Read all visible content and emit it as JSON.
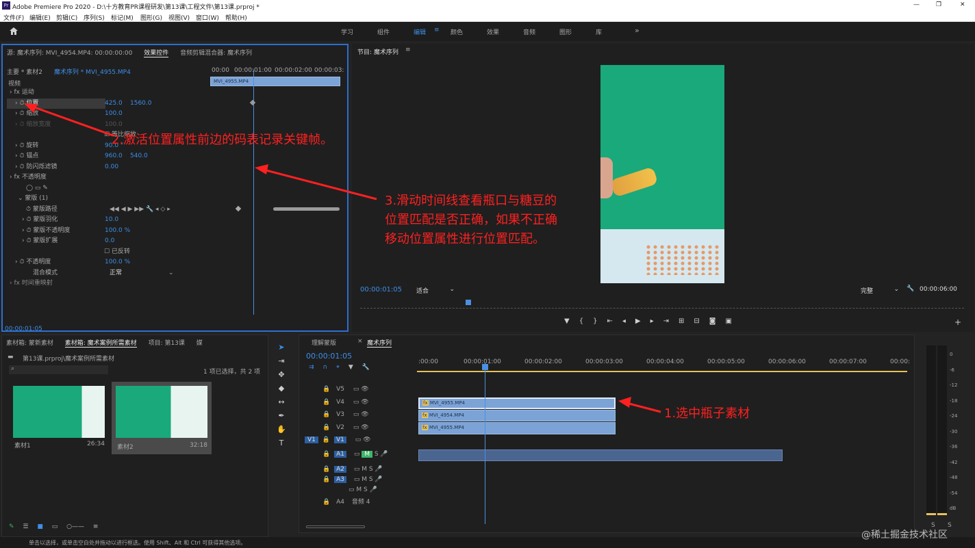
{
  "app": {
    "title": "Adobe Premiere Pro 2020 - D:\\十方教育PR课程研发\\第13课\\工程文件\\第13课.prproj *",
    "icon_label": "Pr",
    "win_controls": [
      "—",
      "❐",
      "✕"
    ]
  },
  "menu": [
    "文件(F)",
    "编辑(E)",
    "剪辑(C)",
    "序列(S)",
    "标记(M)",
    "图形(G)",
    "视图(V)",
    "窗口(W)",
    "帮助(H)"
  ],
  "workspaces": [
    "学习",
    "组件",
    "编辑",
    "颜色",
    "效果",
    "音频",
    "图形",
    "库"
  ],
  "workspace_more": "»",
  "effect_controls": {
    "tabs": [
      "源: 魔术序列: MVI_4954.MP4: 00:00:00:00",
      "效果控件",
      "音频剪辑混合器: 魔术序列"
    ],
    "clip_path": "主要 * 素材2",
    "clip_target": "魔术序列 * MVI_4955.MP4",
    "ruler": [
      "00:00",
      "00:00:01:00",
      "00:00:02:00",
      "00:00:03:"
    ],
    "clip_bar": "MVI_4955.MP4",
    "video_label": "视频",
    "props": [
      {
        "name": "fx 运动",
        "v1": "",
        "v2": ""
      },
      {
        "name": "位置",
        "v1": "425.0",
        "v2": "1560.0"
      },
      {
        "name": "缩放",
        "v1": "100.0",
        "v2": ""
      },
      {
        "name": "缩放宽度",
        "v1": "100.0",
        "v2": ""
      },
      {
        "name": "等比缩放",
        "v1": "",
        "v2": ""
      },
      {
        "name": "旋转",
        "v1": "90.0 °",
        "v2": ""
      },
      {
        "name": "锚点",
        "v1": "960.0",
        "v2": "540.0"
      },
      {
        "name": "防闪烁滤镜",
        "v1": "0.00",
        "v2": ""
      },
      {
        "name": "fx 不透明度",
        "v1": "",
        "v2": ""
      },
      {
        "name": "",
        "v1": "",
        "v2": ""
      },
      {
        "name": "蒙版 (1)",
        "v1": "",
        "v2": ""
      },
      {
        "name": "蒙版路径",
        "v1": "",
        "v2": ""
      },
      {
        "name": "蒙版羽化",
        "v1": "10.0",
        "v2": ""
      },
      {
        "name": "蒙版不透明度",
        "v1": "100.0 %",
        "v2": ""
      },
      {
        "name": "蒙版扩展",
        "v1": "0.0",
        "v2": ""
      },
      {
        "name": "已反转",
        "v1": "",
        "v2": ""
      },
      {
        "name": "不透明度",
        "v1": "100.0 %",
        "v2": ""
      },
      {
        "name": "混合模式",
        "v1": "正常",
        "v2": ""
      },
      {
        "name": "fx 时间重映射",
        "v1": "",
        "v2": ""
      }
    ],
    "timecode": "00:00:01:05"
  },
  "program": {
    "title": "节目: 魔术序列",
    "timecode": "00:00:01:05",
    "fit": "适合",
    "quality": "完整",
    "duration": "00:00:06:00"
  },
  "project": {
    "tabs": [
      "素材箱: 蒙新素材",
      "素材箱: 魔术案例所需素材",
      "项目: 第13课",
      "媒"
    ],
    "path": "第13课.prproj\\魔术案例所需素材",
    "selection": "1 项已选择，共 2 项",
    "items": [
      {
        "name": "素材1",
        "dur": "26:34"
      },
      {
        "name": "素材2",
        "dur": "32:18"
      }
    ]
  },
  "timeline": {
    "tabs": [
      "理解蒙版",
      "魔术序列"
    ],
    "timecode": "00:00:01:05",
    "ruler": [
      ":00:00",
      "00:00:01:00",
      "00:00:02:00",
      "00:00:03:00",
      "00:00:04:00",
      "00:00:05:00",
      "00:00:06:00",
      "00:00:07:00",
      "00:00:"
    ],
    "video_tracks": [
      "V5",
      "V4",
      "V3",
      "V2",
      "V1"
    ],
    "audio_tracks": [
      "A1",
      "A2",
      "A3",
      "A4"
    ],
    "src_v": "V1",
    "audio4_name": "音频 4",
    "clips": [
      "MVI_4955.MP4",
      "MVI_4954.MP4",
      "MVI_4955.MP4"
    ],
    "meter_labels": [
      "0",
      "-6",
      "-12",
      "-18",
      "-24",
      "-30",
      "-36",
      "-42",
      "-48",
      "-54",
      "dB"
    ],
    "solo": [
      "S",
      "S"
    ]
  },
  "annotations": {
    "a1": "1.选中瓶子素材",
    "a2": "2.激活位置属性前边的码表记录关键帧。",
    "a3": [
      "3.滑动时间线查看瓶口与糖豆的",
      "位置匹配是否正确，如果不正确",
      "移动位置属性进行位置匹配。"
    ]
  },
  "status": "单击以选择，或单击空白处并拖动以进行框选。使用 Shift、Alt 和 Ctrl 可获得其他选项。",
  "watermark": "@稀土掘金技术社区",
  "colors": {
    "accent": "#3d8ee8",
    "annotation": "#ff2020",
    "clip": "#7ca3d6"
  }
}
